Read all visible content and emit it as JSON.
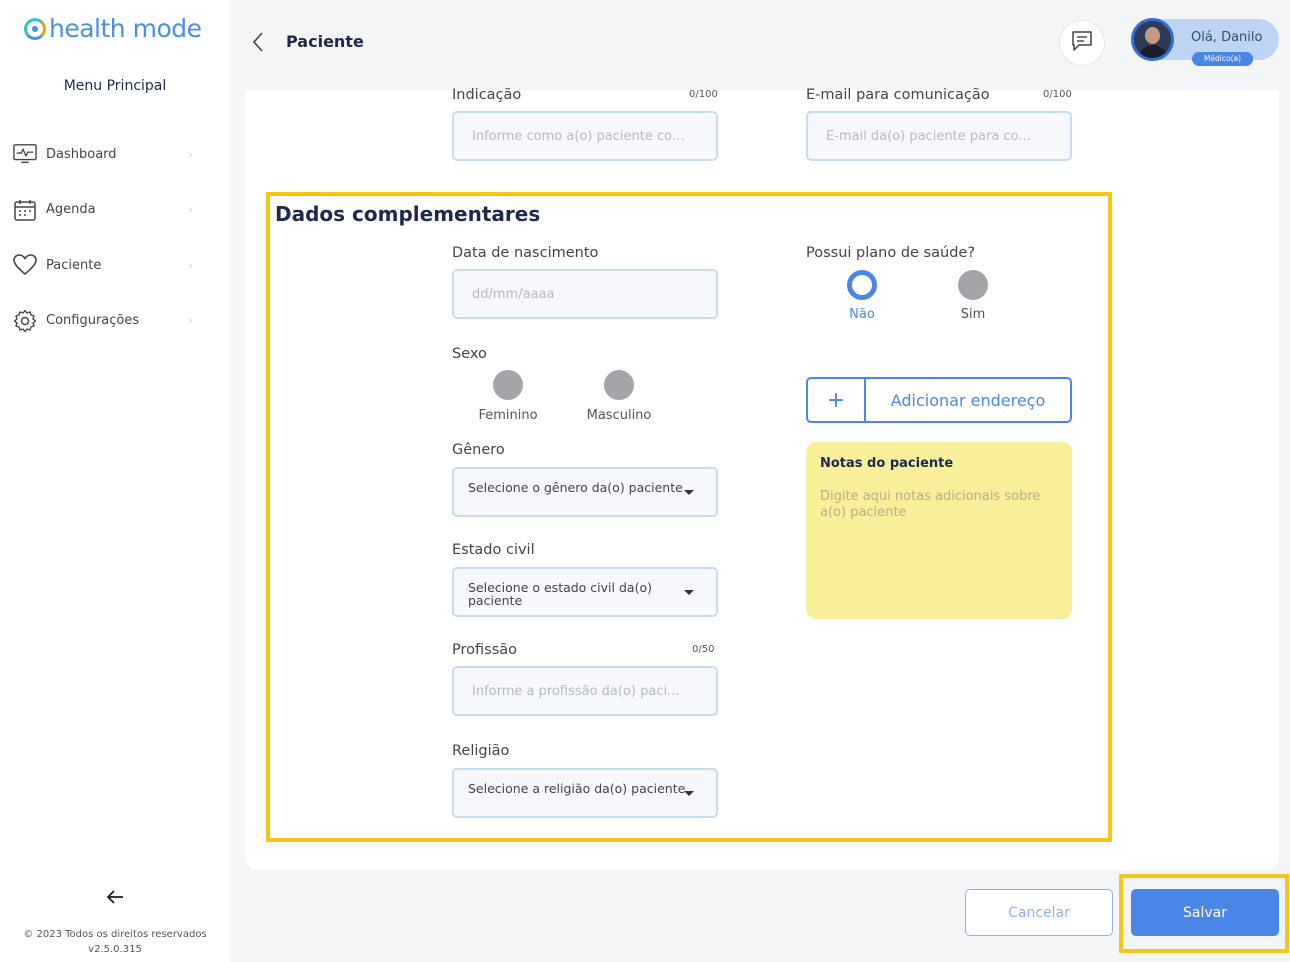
{
  "app": {
    "logo_text": "health mode",
    "brand_color": "#4a90e2",
    "accent_color": "#4a86e8",
    "highlight_color": "#f5c518"
  },
  "sidebar": {
    "menu_title": "Menu Principal",
    "items": [
      {
        "label": "Dashboard",
        "icon": "dashboard-monitor-icon"
      },
      {
        "label": "Agenda",
        "icon": "calendar-icon"
      },
      {
        "label": "Paciente",
        "icon": "heart-icon"
      },
      {
        "label": "Configurações",
        "icon": "gear-icon"
      }
    ],
    "copyright": "© 2023 Todos os direitos reservados",
    "version": "v2.5.0.315"
  },
  "header": {
    "title": "Paciente",
    "greeting": "Olá, Danilo",
    "role": "Médico(a)"
  },
  "form": {
    "indicacao": {
      "label": "Indicação",
      "counter": "0/100",
      "placeholder": "Informe como a(o) paciente co..."
    },
    "email": {
      "label": "E-mail para comunicação",
      "counter": "0/100",
      "placeholder": "E-mail da(o) paciente para co..."
    },
    "section_title": "Dados complementares",
    "nascimento": {
      "label": "Data de nascimento",
      "placeholder": "dd/mm/aaaa"
    },
    "plano": {
      "label": "Possui plano de saúde?",
      "options": [
        "Não",
        "Sim"
      ],
      "selected": "Não"
    },
    "sexo": {
      "label": "Sexo",
      "options": [
        "Feminino",
        "Masculino"
      ]
    },
    "genero": {
      "label": "Gênero",
      "placeholder": "Selecione o gênero da(o) paciente"
    },
    "estado_civil": {
      "label": "Estado civil",
      "placeholder": "Selecione o estado civil da(o) paciente"
    },
    "profissao": {
      "label": "Profissão",
      "counter": "0/50",
      "placeholder": "Informe a profissão da(o) paci..."
    },
    "religiao": {
      "label": "Religião",
      "placeholder": "Selecione a religião da(o) paciente"
    },
    "add_address": "Adicionar endereço",
    "notes": {
      "title": "Notas do paciente",
      "placeholder": "Digite aqui notas adicionais sobre a(o) paciente"
    }
  },
  "actions": {
    "cancel": "Cancelar",
    "save": "Salvar"
  }
}
